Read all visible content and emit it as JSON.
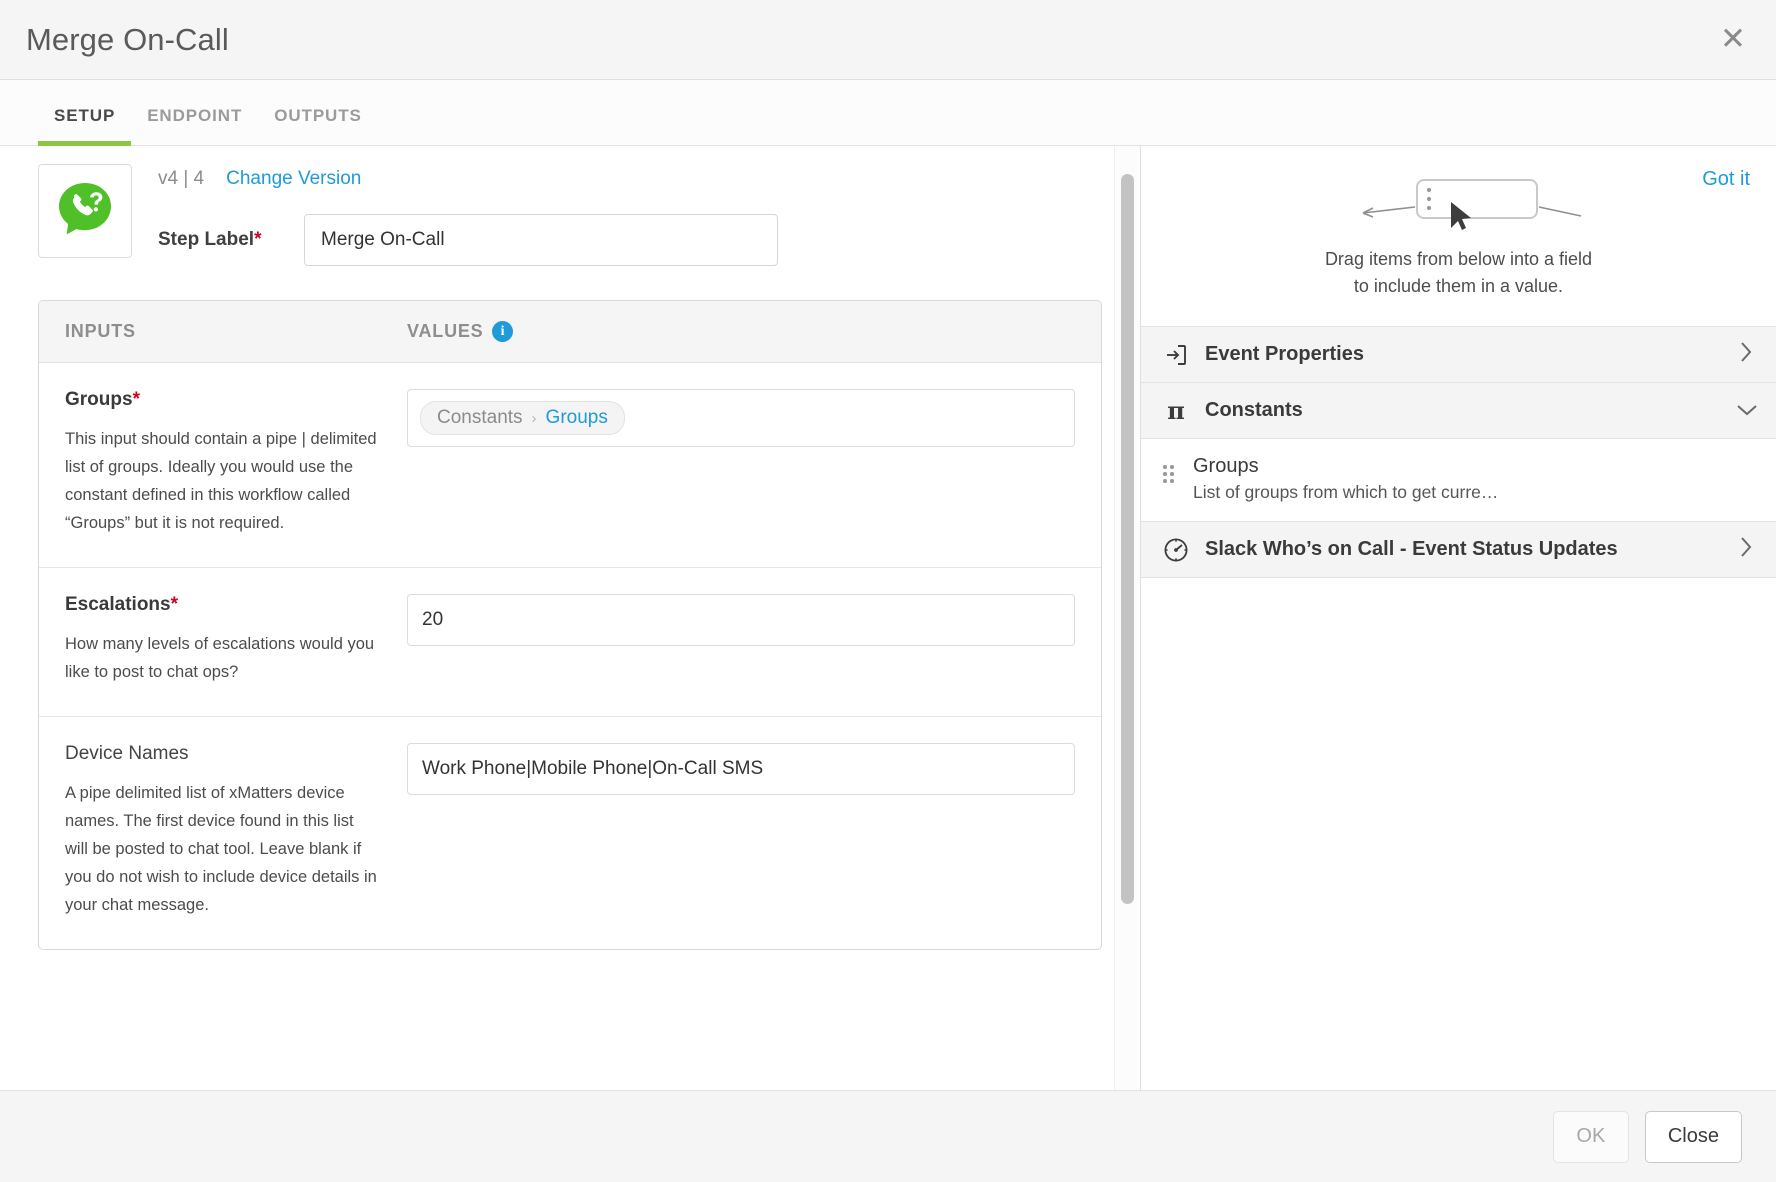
{
  "window": {
    "title": "Merge On-Call",
    "close_icon": "close-icon",
    "close_glyph": "✕"
  },
  "tabs": [
    {
      "label": "SETUP",
      "active": true
    },
    {
      "label": "ENDPOINT",
      "active": false
    },
    {
      "label": "OUTPUTS",
      "active": false
    }
  ],
  "step": {
    "app_icon": "phone-question-bubble-icon",
    "version_text": "v4 | 4",
    "change_version_label": "Change Version",
    "step_label_caption": "Step Label",
    "step_label_required_mark": "*",
    "step_label_value": "Merge On-Call",
    "step_label_placeholder": "Step Label"
  },
  "io_table": {
    "header": {
      "inputs": "INPUTS",
      "values": "VALUES",
      "info_icon": "info-icon",
      "info_glyph": "i"
    },
    "rows": [
      {
        "name": "Groups",
        "required_mark": "*",
        "required": true,
        "description": "This input should contain a pipe | delimited list of groups. Ideally you would use the constant defined in this workflow called “Groups” but it is not required.",
        "value_type": "token",
        "token": {
          "source": "Constants",
          "separator": "›",
          "name": "Groups"
        }
      },
      {
        "name": "Escalations",
        "required_mark": "*",
        "required": true,
        "description": "How many levels of escalations would you like to post to chat ops?",
        "value_type": "text",
        "value": "20"
      },
      {
        "name": "Device Names",
        "required_mark": "",
        "required": false,
        "description": "A pipe delimited list of xMatters device names. The first device found in this list will be posted to chat tool. Leave blank if you do not wish to include device details in your chat message.",
        "value_type": "text",
        "value": "Work Phone|Mobile Phone|On-Call SMS"
      }
    ]
  },
  "drag_panel": {
    "got_it_label": "Got it",
    "hint_icon": "drag-field-illustration",
    "hint_line1": "Drag items from below into a field",
    "hint_line2": "to include them in a value.",
    "sections": [
      {
        "id": "event-properties",
        "icon": "event-properties-icon",
        "title": "Event Properties",
        "chevron": "›",
        "expanded": false,
        "items": []
      },
      {
        "id": "constants",
        "icon": "pi-icon",
        "icon_glyph": "π",
        "title": "Constants",
        "chevron": "⌄",
        "expanded": true,
        "items": [
          {
            "handle_icon": "drag-handle-icon",
            "title": "Groups",
            "subtitle": "List of groups from which to get curre…"
          }
        ]
      },
      {
        "id": "slack-whos-on-call",
        "icon": "gauge-icon",
        "title": "Slack Who’s on Call - Event Status Updates",
        "chevron": "›",
        "expanded": false,
        "items": []
      }
    ]
  },
  "footer": {
    "ok_label": "OK",
    "ok_disabled": true,
    "close_label": "Close"
  },
  "colors": {
    "accent_green": "#8dc63f",
    "link_blue": "#1f9bd8",
    "required_red": "#d0021b",
    "icon_green": "#4fc028",
    "titlebar_bg": "#f5f5f5",
    "section_bg": "#f4f4f4"
  }
}
